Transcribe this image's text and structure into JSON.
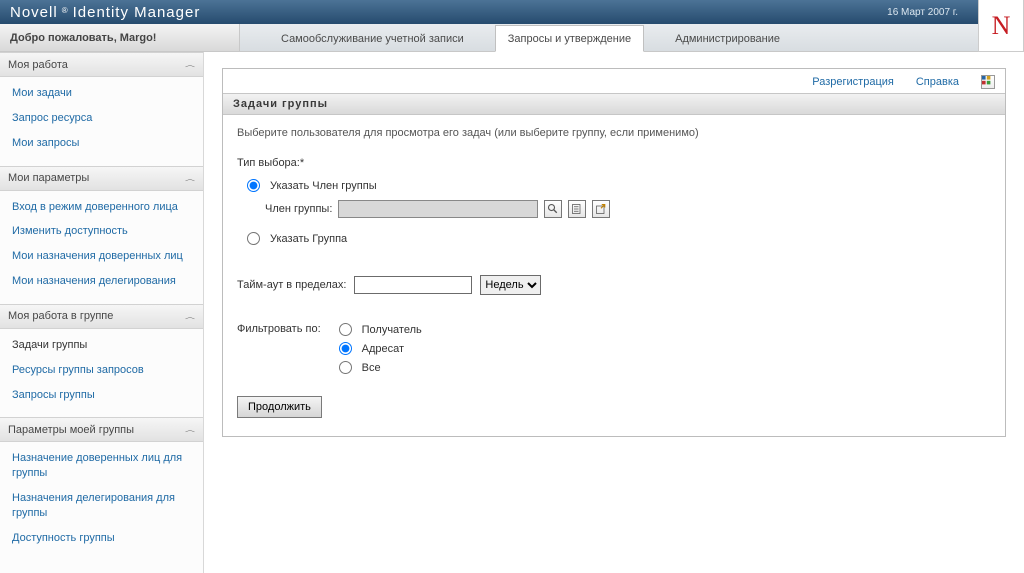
{
  "header": {
    "brand_a": "Novell",
    "brand_reg": "®",
    "brand_b": "Identity Manager",
    "date": "16 Март 2007 г.",
    "logo_letter": "N"
  },
  "welcome": "Добро пожаловать, Margo!",
  "tabs": {
    "account": "Самообслуживание учетной записи",
    "requests": "Запросы и утверждение",
    "admin": "Администрирование"
  },
  "sidebar": {
    "g1_title": "Моя работа",
    "g1": {
      "a": "Мои задачи",
      "b": "Запрос ресурса",
      "c": "Мои запросы"
    },
    "g2_title": "Мои параметры",
    "g2": {
      "a": "Вход в режим доверенного лица",
      "b": "Изменить доступность",
      "c": "Мои назначения доверенных лиц",
      "d": "Мои назначения делегирования"
    },
    "g3_title": "Моя работа в группе",
    "g3": {
      "a": "Задачи группы",
      "b": "Ресурсы группы запросов",
      "c": "Запросы группы"
    },
    "g4_title": "Параметры моей группы",
    "g4": {
      "a": "Назначение доверенных лиц для группы",
      "b": "Назначения делегирования для группы",
      "c": "Доступность группы"
    }
  },
  "panel": {
    "title": "Задачи группы",
    "link_reg": "Разрегистрация",
    "link_help": "Справка",
    "instr": "Выберите пользователя для просмотра его задач (или выберите группу, если применимо)",
    "type_label": "Тип выбора:*",
    "radio_member": "Указать Член группы",
    "member_label": "Член группы:",
    "radio_group": "Указать Группа",
    "timeout_label": "Тайм-аут в пределах:",
    "timeout_unit": "Недель",
    "filter_label": "Фильтровать по:",
    "filter_a": "Получатель",
    "filter_b": "Адресат",
    "filter_c": "Все",
    "continue": "Продолжить"
  }
}
